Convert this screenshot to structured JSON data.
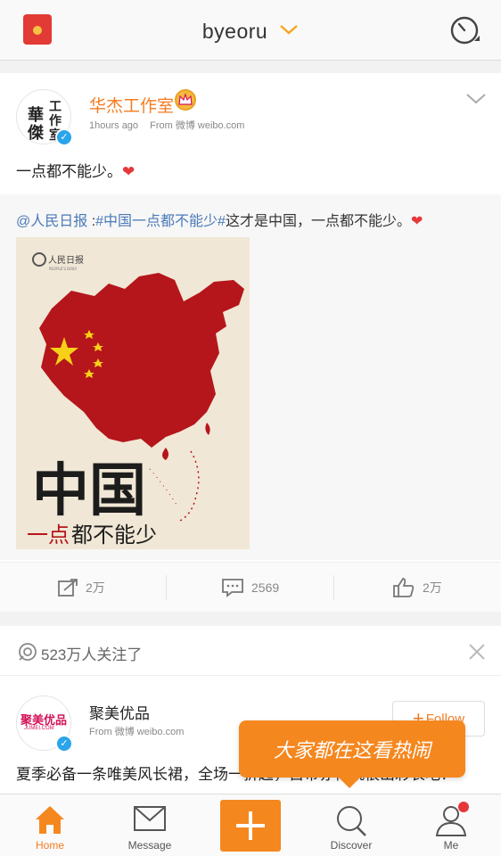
{
  "header": {
    "title": "byeoru"
  },
  "post": {
    "author": "华杰工作室",
    "avatar_chars": [
      "華",
      "傑",
      "工",
      "作",
      "室"
    ],
    "time": "1hours ago",
    "source": "From 微博 weibo.com",
    "text": "一点都不能少。",
    "repost": {
      "mention": "@人民日报",
      "colon": " :",
      "hashtag": "#中国一点都不能少#",
      "rest": "这才是中国，一点都不能少。",
      "image": {
        "logo": "人民日报",
        "logo_sub": "PEOPLE'S DAILY",
        "headline": "中国",
        "tagline_accent": "一点",
        "tagline_rest": "都不能少"
      }
    },
    "actions": {
      "repost_count": "2万",
      "comment_count": "2569",
      "like_count": "2万"
    }
  },
  "recommend": {
    "followers_text": "523万人关注了",
    "author": "聚美优品",
    "logo_text": "聚美优品",
    "logo_sub": "JUMEI.COM",
    "source": "From 微博 weibo.com",
    "follow_label": "Follow",
    "text": "夏季必备一条唯美风长裙，全场一折起，自带亦神就很出彩表吧！"
  },
  "tooltip": {
    "text": "大家都在这看热闹"
  },
  "tabs": [
    {
      "label": "Home"
    },
    {
      "label": "Message"
    },
    {
      "label": ""
    },
    {
      "label": "Discover"
    },
    {
      "label": "Me"
    }
  ],
  "colors": {
    "accent": "#f57b21",
    "link": "#4a7ab8",
    "heart": "#e5383b"
  }
}
